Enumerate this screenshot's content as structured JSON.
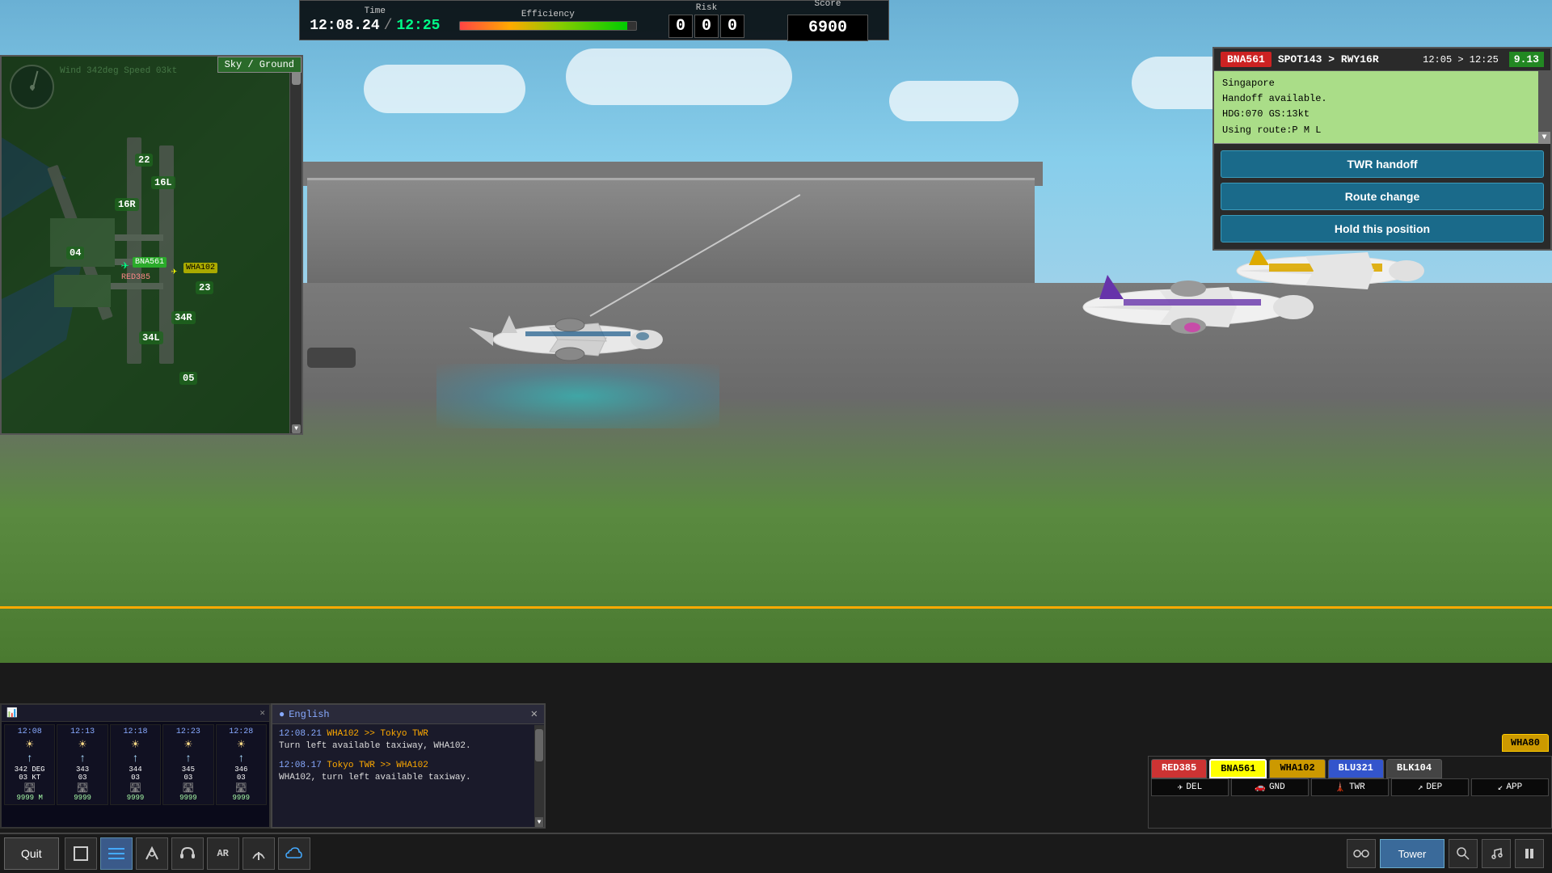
{
  "hud": {
    "time_label": "Time",
    "efficiency_label": "Efficiency",
    "risk_label": "Risk",
    "score_label": "Score",
    "time_current": "12:08.24",
    "time_separator": "/",
    "time_target": "12:25",
    "efficiency_percent": 95,
    "risk_digit1": "0",
    "risk_digit2": "0",
    "risk_digit3": "0",
    "score_value": "6900"
  },
  "map": {
    "view_toggle": "Sky / Ground",
    "wind_label": "Wind 342deg Speed 03kt",
    "runway_labels": [
      "22",
      "16L",
      "16R",
      "04",
      "34L",
      "34R",
      "23",
      "05"
    ],
    "aircraft_marker": "BNA561",
    "aircraft_marker2": "WHA102",
    "aircraft_marker3": "RED385"
  },
  "aircraft_panel": {
    "callsign": "BNA561",
    "route": "SPOT143 > RWY16R",
    "time_range": "12:05 > 12:25",
    "score": "9.13",
    "airport": "Singapore",
    "handoff_status": "Handoff available.",
    "heading": "HDG:070 GS:13kt",
    "route_info": "Using route:P M L",
    "btn_twr_handoff": "TWR handoff",
    "btn_route_change": "Route change",
    "btn_hold_position": "Hold this position"
  },
  "comm_panel": {
    "language": "English",
    "msg1_time": "12:08.21",
    "msg1_sender": "WHA102 >> Tokyo TWR",
    "msg1_text1": "Turn left available taxiway, WHA102.",
    "msg2_time": "12:08.17",
    "msg2_sender": "Tokyo TWR >> WHA102",
    "msg2_text1": "WHA102, turn left available taxiway."
  },
  "weather": {
    "times": [
      "12:08",
      "12:13",
      "12:18",
      "12:23",
      "12:28"
    ],
    "conditions": [
      "☀",
      "☀",
      "☀",
      "☀",
      "☀"
    ],
    "degrees": [
      "342 DEG",
      "343 03",
      "344 03",
      "345 03",
      "346 03"
    ],
    "speeds": [
      "03 KT",
      "03",
      "03",
      "03",
      "03"
    ],
    "visibility": [
      "9999 M",
      "9999",
      "9999",
      "9999",
      "9999"
    ]
  },
  "aircraft_tabs": {
    "tab_wha80": "WHA80",
    "tab_red385": "RED385",
    "tab_bna561": "BNA561",
    "tab_wha102": "WHA102",
    "tab_blu321": "BLU321",
    "tab_blk104": "BLK104",
    "status_del": "DEL",
    "status_gnd": "GND",
    "status_twr": "TWR",
    "status_dep": "DEP",
    "status_app": "APP"
  },
  "toolbar": {
    "quit_label": "Quit",
    "view_tower": "Tower",
    "view_binoculars": "👁",
    "pause_label": "⏸"
  }
}
